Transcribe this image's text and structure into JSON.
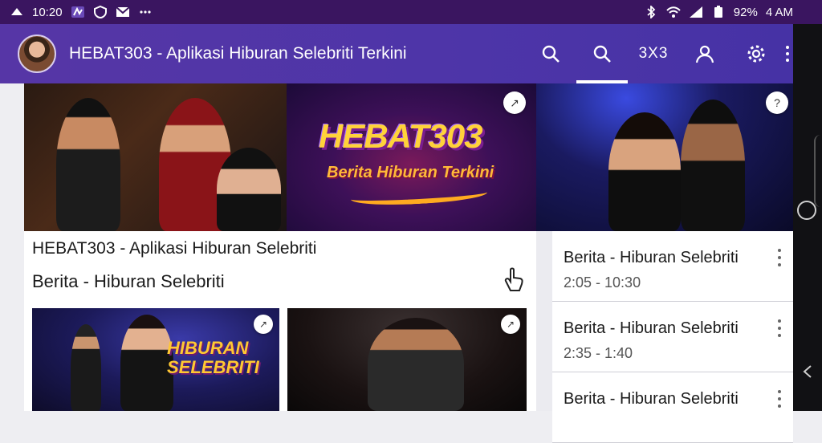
{
  "status_bar": {
    "time": "10:20",
    "battery": "92%",
    "clock_right": "4 AM",
    "left_icons": [
      "notification-icon",
      "app-icon",
      "shield-icon",
      "mail-icon",
      "more-dots-icon"
    ],
    "right_icons": [
      "bluetooth-icon",
      "wifi-icon",
      "signal-icon",
      "battery-icon"
    ]
  },
  "appbar": {
    "title": "HEBAT303 - Aplikasi Hiburan Selebriti Terkini",
    "code_label": "3X3",
    "actions": [
      "search-icon",
      "search-icon",
      "code",
      "person-icon",
      "settings-icon"
    ]
  },
  "hero": {
    "logo_main": "HEBAT303",
    "logo_sub": "Berita Hiburan Terkini"
  },
  "main_card": {
    "line1": "HEBAT303 - Aplikasi Hiburan Selebriti",
    "line2": "Berita - Hiburan Selebriti",
    "thumb1_text": "HIBURAN SELEBRITI"
  },
  "right_list": {
    "items": [
      {
        "title": "Berita - Hiburan Selebriti",
        "subtitle": "2:05 - 10:30"
      },
      {
        "title": "Berita - Hiburan Selebriti",
        "subtitle": "2:35 - 1:40"
      },
      {
        "title": "Berita - Hiburan Selebriti",
        "subtitle": ""
      }
    ]
  },
  "colors": {
    "status_bar": "#3a1560",
    "appbar": "#4d35a8",
    "accent_logo": "#ffd23a"
  }
}
